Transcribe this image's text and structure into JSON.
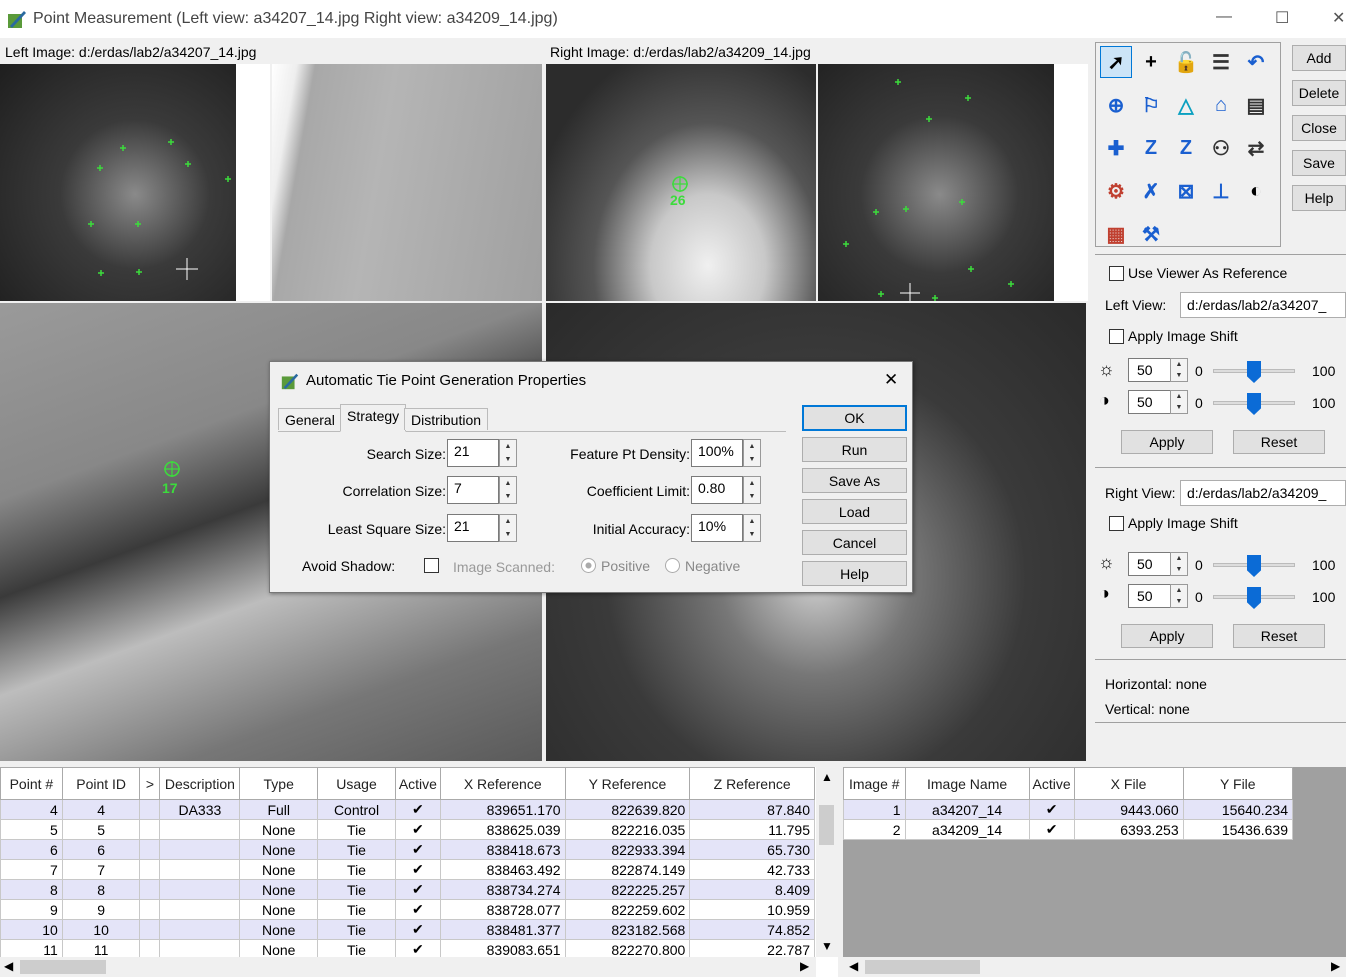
{
  "window": {
    "title": "Point Measurement (Left view: a34207_14.jpg  Right view: a34209_14.jpg)",
    "minimize": "—",
    "maximize": "☐",
    "close": "✕"
  },
  "left_image_label": "Left Image: d:/erdas/lab2/a34207_14.jpg",
  "right_image_label": "Right Image: d:/erdas/lab2/a34209_14.jpg",
  "overlays": {
    "point_26": "26",
    "point_17": "17"
  },
  "side_buttons": {
    "add": "Add",
    "delete": "Delete",
    "close": "Close",
    "save": "Save",
    "help": "Help"
  },
  "toolbar_icons": [
    "select-arrow-icon",
    "crosshair-icon",
    "lock-icon",
    "table-icon",
    "undo-icon",
    "create-point-icon",
    "drive-icon",
    "triangle-icon",
    "roof-icon",
    "report-icon",
    "add-point-icon",
    "z-icon",
    "z-box-icon",
    "stamp-icon",
    "swap-icon",
    "adjust-icon",
    "x-mark-icon",
    "x-box-icon",
    "level-icon",
    "circle-icon",
    "grid-icon",
    "properties-icon"
  ],
  "viewer": {
    "use_as_reference": "Use Viewer As Reference",
    "left_view_label": "Left View:",
    "left_view_value": "d:/erdas/lab2/a34207_",
    "apply_shift": "Apply Image Shift",
    "brightness": "50",
    "contrast": "50",
    "min": "0",
    "max": "100",
    "apply": "Apply",
    "reset": "Reset",
    "brightness_level": 0.5,
    "contrast_level": 0.5
  },
  "right_viewer": {
    "label": "Right View:",
    "value": "d:/erdas/lab2/a34209_",
    "apply_shift": "Apply Image Shift",
    "brightness": "50",
    "contrast": "50",
    "min": "0",
    "max": "100",
    "apply": "Apply",
    "reset": "Reset",
    "brightness_level": 0.5,
    "contrast_level": 0.5
  },
  "status": {
    "horizontal": "Horizontal: none",
    "vertical": "Vertical: none"
  },
  "points_table": {
    "headers": [
      "Point #",
      "Point ID",
      ">",
      "Description",
      "Type",
      "Usage",
      "Active",
      "X Reference",
      "Y Reference",
      "Z Reference"
    ],
    "rows": [
      [
        "4",
        "4",
        "",
        "DA333",
        "Full",
        "Control",
        "✔",
        "839651.170",
        "822639.820",
        "87.840"
      ],
      [
        "5",
        "5",
        "",
        "",
        "None",
        "Tie",
        "✔",
        "838625.039",
        "822216.035",
        "11.795"
      ],
      [
        "6",
        "6",
        "",
        "",
        "None",
        "Tie",
        "✔",
        "838418.673",
        "822933.394",
        "65.730"
      ],
      [
        "7",
        "7",
        "",
        "",
        "None",
        "Tie",
        "✔",
        "838463.492",
        "822874.149",
        "42.733"
      ],
      [
        "8",
        "8",
        "",
        "",
        "None",
        "Tie",
        "✔",
        "838734.274",
        "822225.257",
        "8.409"
      ],
      [
        "9",
        "9",
        "",
        "",
        "None",
        "Tie",
        "✔",
        "838728.077",
        "822259.602",
        "10.959"
      ],
      [
        "10",
        "10",
        "",
        "",
        "None",
        "Tie",
        "✔",
        "838481.377",
        "823182.568",
        "74.852"
      ],
      [
        "11",
        "11",
        "",
        "",
        "None",
        "Tie",
        "✔",
        "839083.651",
        "822270.800",
        "22.787"
      ]
    ]
  },
  "image_table": {
    "headers": [
      "Image #",
      "Image Name",
      "Active",
      "X File",
      "Y File"
    ],
    "rows": [
      [
        "1",
        "a34207_14",
        "✔",
        "9443.060",
        "15640.234"
      ],
      [
        "2",
        "a34209_14",
        "✔",
        "6393.253",
        "15436.639"
      ]
    ]
  },
  "dialog": {
    "title": "Automatic Tie Point Generation Properties",
    "tabs": [
      "General",
      "Strategy",
      "Distribution"
    ],
    "search_size_label": "Search Size:",
    "search_size": "21",
    "correlation_size_label": "Correlation Size:",
    "correlation_size": "7",
    "least_square_label": "Least Square Size:",
    "least_square": "21",
    "feature_density_label": "Feature Pt Density:",
    "feature_density": "100%",
    "coefficient_label": "Coefficient Limit:",
    "coefficient": "0.80",
    "initial_accuracy_label": "Initial Accuracy:",
    "initial_accuracy": "10%",
    "avoid_shadow_label": "Avoid Shadow:",
    "image_scanned": "Image Scanned:",
    "positive": "Positive",
    "negative": "Negative",
    "buttons": {
      "ok": "OK",
      "run": "Run",
      "save_as": "Save As",
      "load": "Load",
      "cancel": "Cancel",
      "help": "Help"
    },
    "close": "✕"
  }
}
